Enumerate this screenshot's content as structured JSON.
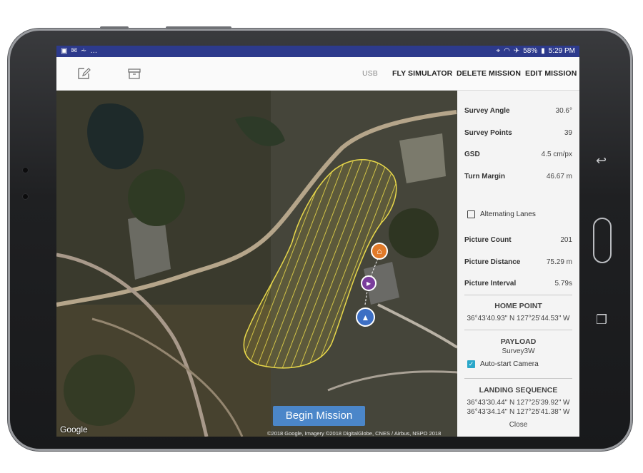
{
  "status_bar": {
    "notification_icons": [
      "image-icon",
      "mail-icon",
      "wifi-signal-icon"
    ],
    "overflow": "…",
    "battery": "58%",
    "time": "5:29 PM"
  },
  "toolbar": {
    "left_icons": [
      "edit-icon",
      "archive-icon"
    ],
    "usb": "USB",
    "fly_simulator": "FLY SIMULATOR",
    "delete_mission": "DELETE MISSION",
    "edit_mission": "EDIT MISSION"
  },
  "map": {
    "begin_button": "Begin Mission",
    "google_logo": "Google",
    "attribution": "©2018 Google, Imagery ©2018 DigitalGlobe, CNES / Airbus, NSPO 2018",
    "markers": [
      "home-icon",
      "waypoint-icon",
      "drone-location-icon"
    ]
  },
  "panel": {
    "survey_angle": {
      "label": "Survey Angle",
      "value": "30.6°"
    },
    "survey_points": {
      "label": "Survey Points",
      "value": "39"
    },
    "gsd": {
      "label": "GSD",
      "value": "4.5 cm/px"
    },
    "turn_margin": {
      "label": "Turn Margin",
      "value": "46.67 m"
    },
    "alternating_lanes": {
      "label": "Alternating Lanes",
      "checked": false
    },
    "picture_count": {
      "label": "Picture Count",
      "value": "201"
    },
    "picture_distance": {
      "label": "Picture Distance",
      "value": "75.29 m"
    },
    "picture_interval": {
      "label": "Picture Interval",
      "value": "5.79s"
    },
    "home_point": {
      "title": "HOME POINT",
      "coords": "36°43'40.93\" N 127°25'44.53\" W"
    },
    "payload": {
      "title": "PAYLOAD",
      "name": "Survey3W"
    },
    "auto_start_camera": {
      "label": "Auto-start Camera",
      "checked": true
    },
    "landing_sequence": {
      "title": "LANDING SEQUENCE",
      "coords": [
        "36°43'30.44\" N 127°25'39.92\" W",
        "36°43'34.14\" N 127°25'41.38\" W"
      ]
    },
    "close": "Close"
  },
  "colors": {
    "status_bar": "#2d3a8c",
    "accent_button": "#4b86c9",
    "survey_outline": "#e8d84a",
    "home_marker": "#e07a2a",
    "waypoint_marker": "#7a3d9c",
    "drone_marker": "#3d6fc4",
    "checkbox_checked": "#2aa7c9"
  }
}
